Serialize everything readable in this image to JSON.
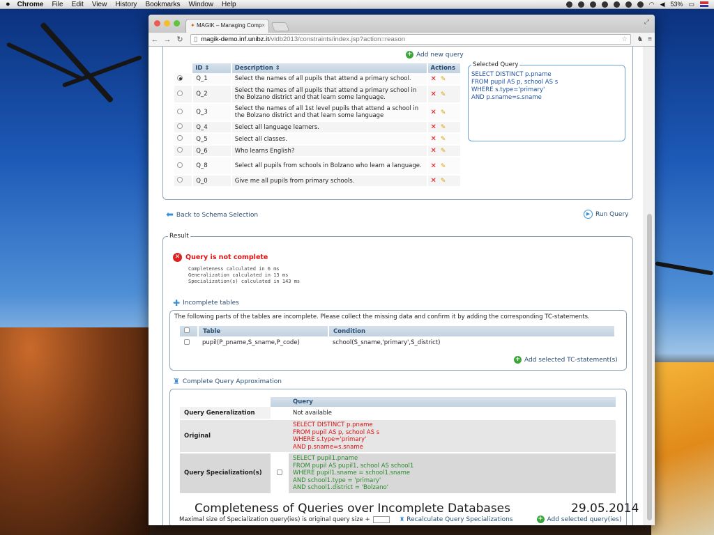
{
  "menubar": {
    "app": "Chrome",
    "items": [
      "File",
      "Edit",
      "View",
      "History",
      "Bookmarks",
      "Window",
      "Help"
    ],
    "battery": "53%"
  },
  "browser": {
    "tab_title": "MAGIK – Managing Comp",
    "url_domain": "magik-demo.inf.unibz.it",
    "url_path": "/vldb2013/constraints/index.jsp?action=reason"
  },
  "queries": {
    "add_new": "Add new query",
    "headers": {
      "id": "ID ⇕",
      "description": "Description ⇕",
      "actions": "Actions"
    },
    "rows": [
      {
        "id": "Q_1",
        "desc": "Select the names of all pupils that attend a primary school.",
        "selected": true
      },
      {
        "id": "Q_2",
        "desc": "Select the names of all pupils that attend a primary school in the Bolzano district and that learn some language.",
        "selected": false
      },
      {
        "id": "Q_3",
        "desc": "Select the names of all 1st level pupils that attend a school in the Bolzano district and that learn some language",
        "selected": false
      },
      {
        "id": "Q_4",
        "desc": "Select all language learners.",
        "selected": false
      },
      {
        "id": "Q_5",
        "desc": "Select all classes.",
        "selected": false
      },
      {
        "id": "Q_6",
        "desc": "Who learns English?",
        "selected": false
      },
      {
        "id": "Q_8",
        "desc": "Select all pupils from schools in Bolzano who learn a language.",
        "selected": false
      },
      {
        "id": "Q_0",
        "desc": "Give me all pupils from primary schools.",
        "selected": false
      }
    ],
    "selected_query": {
      "legend": "Selected Query",
      "lines": [
        "SELECT DISTINCT p.pname",
        "FROM pupil AS p, school AS s",
        "WHERE s.type='primary'",
        "AND p.sname=s.sname"
      ]
    }
  },
  "nav": {
    "back": "Back to Schema Selection",
    "run": "Run Query"
  },
  "result": {
    "legend": "Result",
    "status": "Query is not complete",
    "timings": [
      "Completeness calculated in 6 ms",
      "Generalization calculated in 13 ms",
      "Specialization(s) calculated in 143 ms"
    ],
    "incomplete_title": "Incomplete tables",
    "incomplete_desc": "The following parts of the tables are incomplete. Please collect the missing data and confirm it by adding the corresponding TC-statements.",
    "incomplete_headers": {
      "table": "Table",
      "condition": "Condition"
    },
    "incomplete_row": {
      "table": "pupil(P_pname,S_sname,P_code)",
      "condition": "school(S_sname,'primary',S_district)"
    },
    "add_tc": "Add selected TC-statement(s)",
    "approx_title": "Complete Query Approximation",
    "approx_header": "Query",
    "generalization_label": "Query Generalization",
    "generalization_value": "Not available",
    "original_label": "Original",
    "original_lines": [
      "SELECT DISTINCT p.pname",
      "FROM pupil AS p, school AS s",
      "WHERE s.type='primary'",
      "AND p.sname=s.sname"
    ],
    "specialization_label": "Query Specialization(s)",
    "specialization_lines": [
      "SELECT pupil1.pname",
      "FROM pupil AS pupil1, school AS school1",
      "WHERE pupil1.sname = school1.sname",
      "AND school1.type = 'primary'",
      "AND school1.district = 'Bolzano'"
    ],
    "max_size": "Maximal size of Specialization query(ies) is original query size +",
    "recalc": "Recalculate Query Specializations",
    "add_sel": "Add selected query(ies)"
  },
  "slide": {
    "caption": "Completeness of Queries over Incomplete Databases",
    "date": "29.05.2014"
  }
}
